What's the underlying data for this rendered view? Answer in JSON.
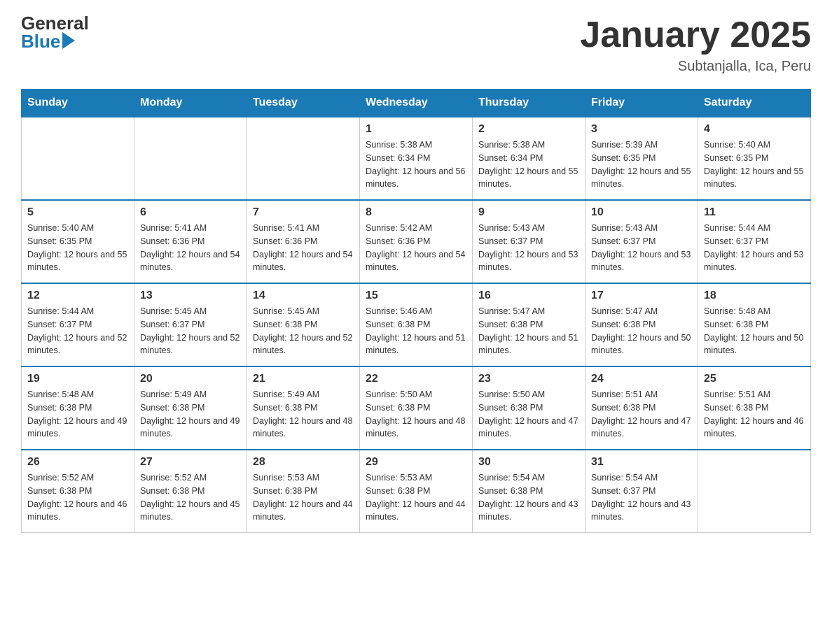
{
  "header": {
    "logo_general": "General",
    "logo_blue": "Blue",
    "calendar_title": "January 2025",
    "calendar_subtitle": "Subtanjalla, Ica, Peru"
  },
  "calendar": {
    "days_of_week": [
      "Sunday",
      "Monday",
      "Tuesday",
      "Wednesday",
      "Thursday",
      "Friday",
      "Saturday"
    ],
    "weeks": [
      [
        {
          "day": "",
          "info": ""
        },
        {
          "day": "",
          "info": ""
        },
        {
          "day": "",
          "info": ""
        },
        {
          "day": "1",
          "info": "Sunrise: 5:38 AM\nSunset: 6:34 PM\nDaylight: 12 hours and 56 minutes."
        },
        {
          "day": "2",
          "info": "Sunrise: 5:38 AM\nSunset: 6:34 PM\nDaylight: 12 hours and 55 minutes."
        },
        {
          "day": "3",
          "info": "Sunrise: 5:39 AM\nSunset: 6:35 PM\nDaylight: 12 hours and 55 minutes."
        },
        {
          "day": "4",
          "info": "Sunrise: 5:40 AM\nSunset: 6:35 PM\nDaylight: 12 hours and 55 minutes."
        }
      ],
      [
        {
          "day": "5",
          "info": "Sunrise: 5:40 AM\nSunset: 6:35 PM\nDaylight: 12 hours and 55 minutes."
        },
        {
          "day": "6",
          "info": "Sunrise: 5:41 AM\nSunset: 6:36 PM\nDaylight: 12 hours and 54 minutes."
        },
        {
          "day": "7",
          "info": "Sunrise: 5:41 AM\nSunset: 6:36 PM\nDaylight: 12 hours and 54 minutes."
        },
        {
          "day": "8",
          "info": "Sunrise: 5:42 AM\nSunset: 6:36 PM\nDaylight: 12 hours and 54 minutes."
        },
        {
          "day": "9",
          "info": "Sunrise: 5:43 AM\nSunset: 6:37 PM\nDaylight: 12 hours and 53 minutes."
        },
        {
          "day": "10",
          "info": "Sunrise: 5:43 AM\nSunset: 6:37 PM\nDaylight: 12 hours and 53 minutes."
        },
        {
          "day": "11",
          "info": "Sunrise: 5:44 AM\nSunset: 6:37 PM\nDaylight: 12 hours and 53 minutes."
        }
      ],
      [
        {
          "day": "12",
          "info": "Sunrise: 5:44 AM\nSunset: 6:37 PM\nDaylight: 12 hours and 52 minutes."
        },
        {
          "day": "13",
          "info": "Sunrise: 5:45 AM\nSunset: 6:37 PM\nDaylight: 12 hours and 52 minutes."
        },
        {
          "day": "14",
          "info": "Sunrise: 5:45 AM\nSunset: 6:38 PM\nDaylight: 12 hours and 52 minutes."
        },
        {
          "day": "15",
          "info": "Sunrise: 5:46 AM\nSunset: 6:38 PM\nDaylight: 12 hours and 51 minutes."
        },
        {
          "day": "16",
          "info": "Sunrise: 5:47 AM\nSunset: 6:38 PM\nDaylight: 12 hours and 51 minutes."
        },
        {
          "day": "17",
          "info": "Sunrise: 5:47 AM\nSunset: 6:38 PM\nDaylight: 12 hours and 50 minutes."
        },
        {
          "day": "18",
          "info": "Sunrise: 5:48 AM\nSunset: 6:38 PM\nDaylight: 12 hours and 50 minutes."
        }
      ],
      [
        {
          "day": "19",
          "info": "Sunrise: 5:48 AM\nSunset: 6:38 PM\nDaylight: 12 hours and 49 minutes."
        },
        {
          "day": "20",
          "info": "Sunrise: 5:49 AM\nSunset: 6:38 PM\nDaylight: 12 hours and 49 minutes."
        },
        {
          "day": "21",
          "info": "Sunrise: 5:49 AM\nSunset: 6:38 PM\nDaylight: 12 hours and 48 minutes."
        },
        {
          "day": "22",
          "info": "Sunrise: 5:50 AM\nSunset: 6:38 PM\nDaylight: 12 hours and 48 minutes."
        },
        {
          "day": "23",
          "info": "Sunrise: 5:50 AM\nSunset: 6:38 PM\nDaylight: 12 hours and 47 minutes."
        },
        {
          "day": "24",
          "info": "Sunrise: 5:51 AM\nSunset: 6:38 PM\nDaylight: 12 hours and 47 minutes."
        },
        {
          "day": "25",
          "info": "Sunrise: 5:51 AM\nSunset: 6:38 PM\nDaylight: 12 hours and 46 minutes."
        }
      ],
      [
        {
          "day": "26",
          "info": "Sunrise: 5:52 AM\nSunset: 6:38 PM\nDaylight: 12 hours and 46 minutes."
        },
        {
          "day": "27",
          "info": "Sunrise: 5:52 AM\nSunset: 6:38 PM\nDaylight: 12 hours and 45 minutes."
        },
        {
          "day": "28",
          "info": "Sunrise: 5:53 AM\nSunset: 6:38 PM\nDaylight: 12 hours and 44 minutes."
        },
        {
          "day": "29",
          "info": "Sunrise: 5:53 AM\nSunset: 6:38 PM\nDaylight: 12 hours and 44 minutes."
        },
        {
          "day": "30",
          "info": "Sunrise: 5:54 AM\nSunset: 6:38 PM\nDaylight: 12 hours and 43 minutes."
        },
        {
          "day": "31",
          "info": "Sunrise: 5:54 AM\nSunset: 6:37 PM\nDaylight: 12 hours and 43 minutes."
        },
        {
          "day": "",
          "info": ""
        }
      ]
    ]
  }
}
